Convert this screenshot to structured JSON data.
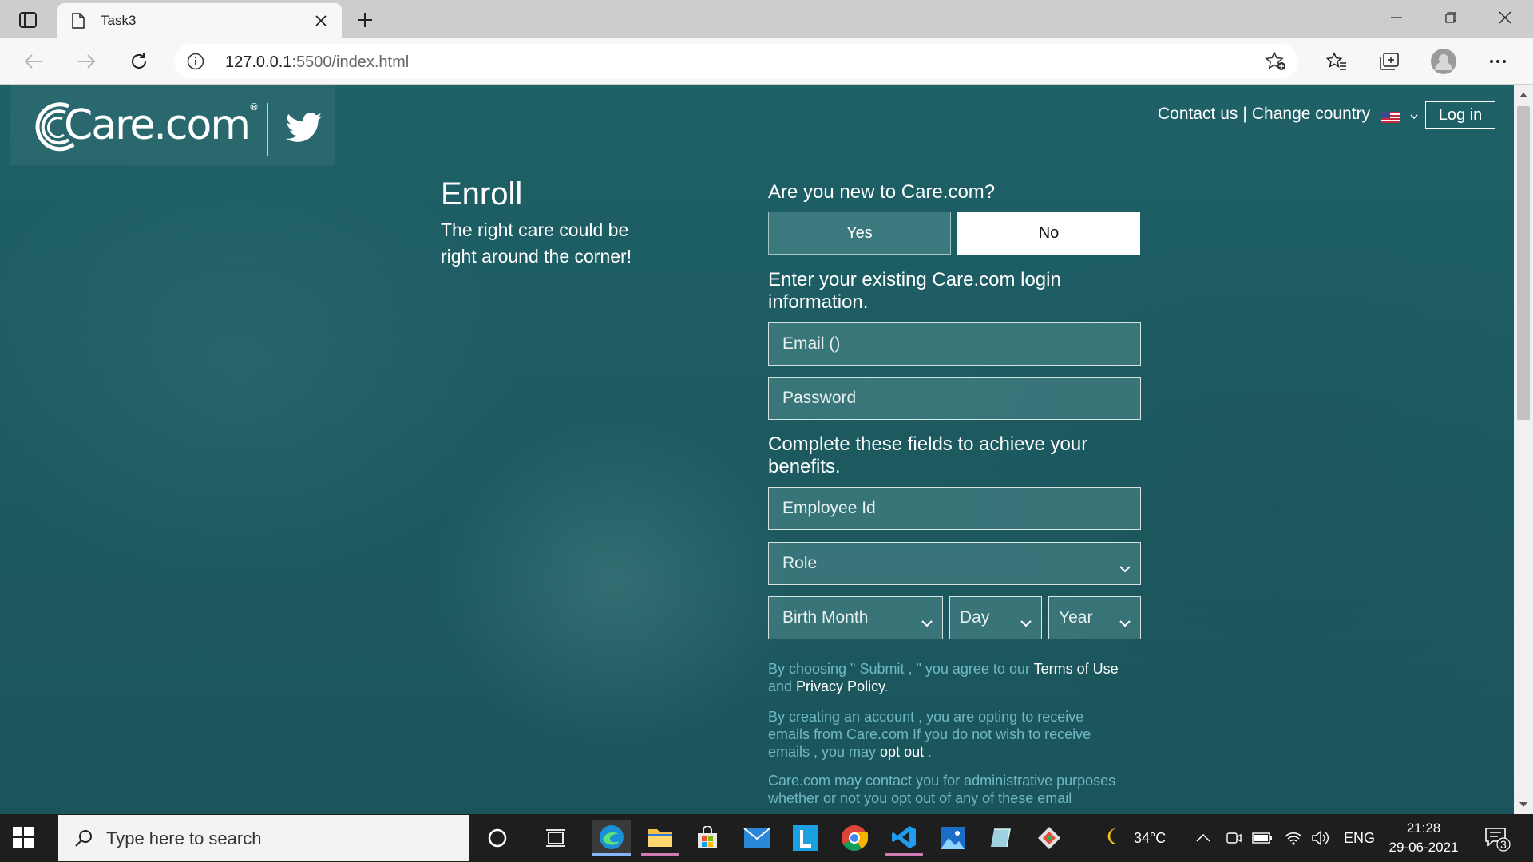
{
  "browser": {
    "tab_title": "Task3",
    "url_host": "127.0.0.1",
    "url_rest": ":5500/index.html"
  },
  "page": {
    "logo_text": "Care.com",
    "logo_reg": "®",
    "header": {
      "contact": "Contact us",
      "separator": "|",
      "change_country": "Change country",
      "login": "Log in"
    },
    "enroll": {
      "title": "Enroll",
      "tagline": "The right care could be right around the corner!"
    },
    "form": {
      "question": "Are you new to Care.com?",
      "yes": "Yes",
      "no": "No",
      "selected": "No",
      "existing_label": "Enter your existing Care.com login information.",
      "email_placeholder": "Email ()",
      "password_placeholder": "Password",
      "complete_label": "Complete these fields to achieve your benefits.",
      "employee_id_placeholder": "Employee Id",
      "role": "Role",
      "birth_month": "Birth Month",
      "day": "Day",
      "year": "Year",
      "legal1_a": "By choosing \" Submit , \" you agree to our ",
      "terms": "Terms of Use",
      "legal1_b": "and ",
      "privacy": "Privacy Policy",
      "legal1_c": ".",
      "legal2_a": "By creating an account , you are opting to receive emails from Care.com If you do not wish to receive emails , you may ",
      "opt_out": "opt out",
      "legal2_b": " .",
      "legal3": "Care.com may contact you for administrative purposes whether or not you opt out of any of these email"
    }
  },
  "taskbar": {
    "search_placeholder": "Type here to search",
    "weather": "34°C",
    "language": "ENG",
    "time": "21:28",
    "date": "29-06-2021",
    "notification_count": "3"
  },
  "colors": {
    "page_bg": "#1f5e63",
    "legal_text": "#6fb9c4"
  }
}
